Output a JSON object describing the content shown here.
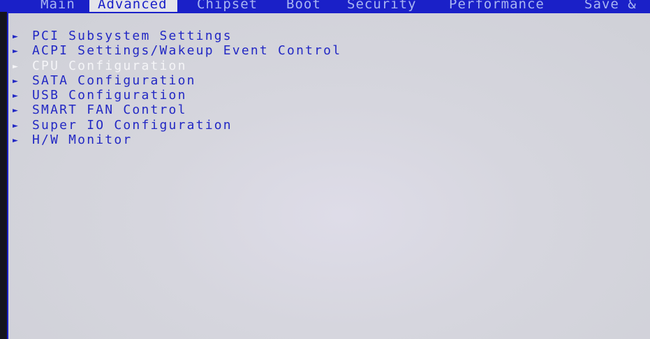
{
  "tabs": [
    {
      "label": "Main"
    },
    {
      "label": "Advanced",
      "active": true
    },
    {
      "label": "Chipset"
    },
    {
      "label": "Boot"
    },
    {
      "label": "Security"
    },
    {
      "label": "Performance"
    },
    {
      "label": "Save &"
    }
  ],
  "menu": {
    "arrow_glyph": "►",
    "items": [
      {
        "label": "PCI Subsystem Settings"
      },
      {
        "label": "ACPI Settings/Wakeup Event Control"
      },
      {
        "label": "CPU Configuration",
        "selected": true
      },
      {
        "label": "SATA Configuration"
      },
      {
        "label": "USB Configuration"
      },
      {
        "label": "SMART FAN Control"
      },
      {
        "label": "Super IO Configuration"
      },
      {
        "label": "H/W Monitor"
      }
    ]
  },
  "colors": {
    "header_blue": "#1a20c8",
    "menu_text": "#2228c4",
    "selected_text": "#f5f5f8",
    "panel_background": "#d6d6de"
  }
}
